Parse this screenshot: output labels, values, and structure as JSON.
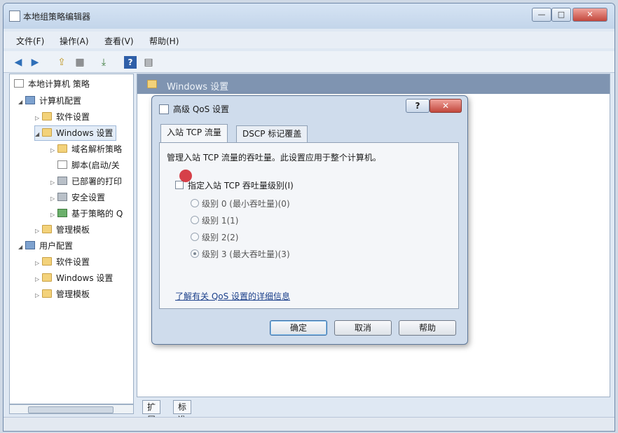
{
  "window": {
    "title": "本地组策略编辑器",
    "min": "—",
    "max": "□",
    "close": "✕"
  },
  "menu": [
    "文件(F)",
    "操作(A)",
    "查看(V)",
    "帮助(H)"
  ],
  "toolbar": {
    "back": "◀",
    "forward": "▶",
    "up": "⇪",
    "view": "▦",
    "export": "⤓",
    "help": "?",
    "props": "▤"
  },
  "tree": {
    "root": "本地计算机 策略",
    "computer_config": "计算机配置",
    "software_settings": "软件设置",
    "windows_settings": "Windows 设置",
    "dns": "域名解析策略",
    "scripts": "脚本(启动/关",
    "printers": "已部署的打印",
    "security": "安全设置",
    "qos": "基于策略的 Q",
    "admin_templates": "管理模板",
    "user_config": "用户配置",
    "user_software": "软件设置",
    "user_windows": "Windows 设置",
    "user_admin": "管理模板"
  },
  "right_pane": {
    "title": "Windows 设置"
  },
  "bottom_tabs": [
    "扩展",
    "标准"
  ],
  "dialog": {
    "title": "高级 QoS 设置",
    "help": "?",
    "close": "✕",
    "tabs": [
      "入站 TCP 流量",
      "DSCP 标记覆盖"
    ],
    "description": "管理入站 TCP 流量的吞吐量。此设置应用于整个计算机。",
    "checkbox_label": "指定入站 TCP 吞吐量级别(I)",
    "levels": [
      {
        "label": "级别 0 (最小吞吐量)(0)",
        "selected": false
      },
      {
        "label": "级别 1(1)",
        "selected": false
      },
      {
        "label": "级别 2(2)",
        "selected": false
      },
      {
        "label": "级别 3 (最大吞吐量)(3)",
        "selected": true
      }
    ],
    "link": "了解有关 QoS 设置的详细信息",
    "ok": "确定",
    "cancel": "取消",
    "help_button": "帮助"
  }
}
